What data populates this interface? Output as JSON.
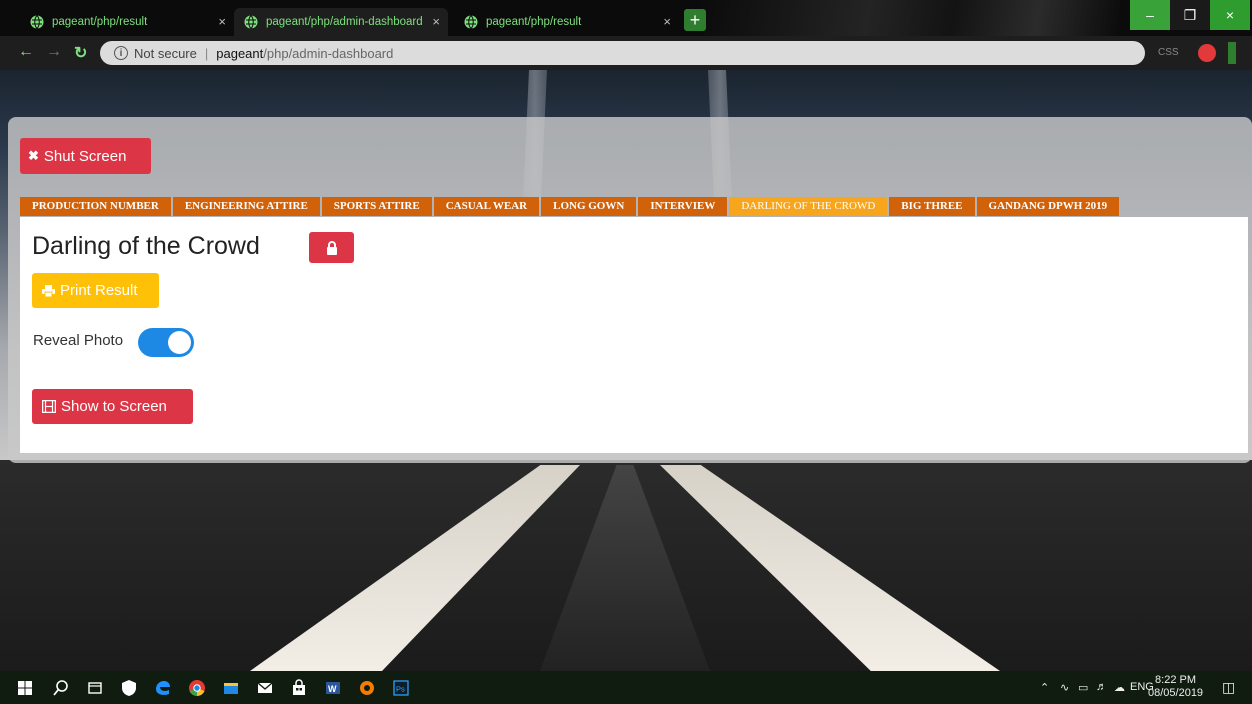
{
  "browser": {
    "tabs": [
      {
        "label": "pageant/php/result",
        "active": false
      },
      {
        "label": "pageant/php/admin-dashboard",
        "active": true
      },
      {
        "label": "pageant/php/result",
        "active": false
      }
    ],
    "tab_close_glyph": "×",
    "new_tab_glyph": "+",
    "window_buttons": {
      "minimize": "–",
      "maximize": "❐",
      "close": "×"
    },
    "address": {
      "security": "Not secure",
      "host": "pageant",
      "path": "/php/admin-dashboard"
    },
    "extension_label": "CSS",
    "accent_color": "#7ee07e"
  },
  "toolbar": {
    "shut_label": "Shut Screen"
  },
  "tabs": [
    {
      "label": "PRODUCTION NUMBER",
      "active": false
    },
    {
      "label": "ENGINEERING ATTIRE",
      "active": false
    },
    {
      "label": "SPORTS ATTIRE",
      "active": false
    },
    {
      "label": "CASUAL WEAR",
      "active": false
    },
    {
      "label": "LONG GOWN",
      "active": false
    },
    {
      "label": "INTERVIEW",
      "active": false
    },
    {
      "label": "DARLING OF THE CROWD",
      "active": true
    },
    {
      "label": "BIG THREE",
      "active": false
    },
    {
      "label": "GANDANG DPWH 2019",
      "active": false
    }
  ],
  "content": {
    "title": "Darling of the Crowd",
    "print_label": "Print Result",
    "reveal_label": "Reveal Photo",
    "reveal_on": true,
    "show_label": "Show to Screen"
  },
  "taskbar": {
    "time": "8:22 PM",
    "date": "08/05/2019",
    "lang": "ENG"
  },
  "colors": {
    "danger": "#dc3545",
    "warning": "#ffc107",
    "tab": "#d2620a",
    "tab_active": "#f7a51c",
    "toggle": "#1e88e5"
  }
}
